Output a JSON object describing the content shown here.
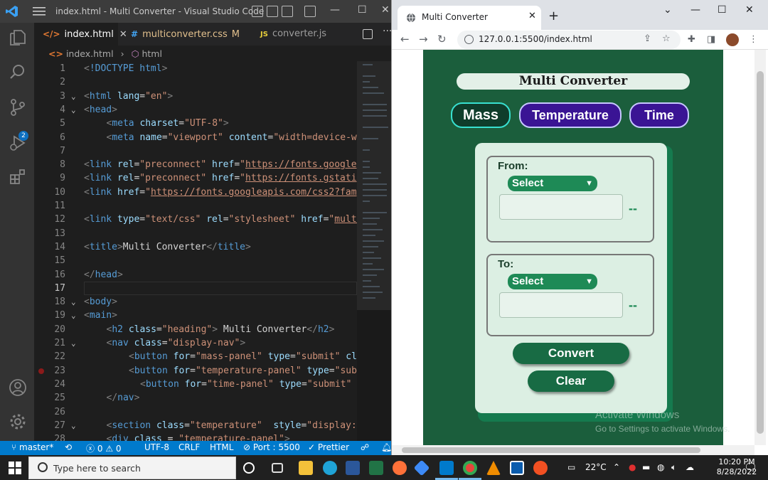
{
  "vscode": {
    "window_title": "index.html - Multi Converter - Visual Studio Code",
    "tabs": [
      {
        "icon": "</>",
        "label": "index.html",
        "active": true
      },
      {
        "icon": "#",
        "label": "multiconverter.css",
        "modified": "M"
      },
      {
        "icon": "JS",
        "label": "converter.js"
      }
    ],
    "breadcrumb": {
      "file": "index.html",
      "node": "html"
    },
    "scm_badge": "2",
    "lines": [
      {
        "n": "1",
        "tokens": [
          [
            "ang",
            "<"
          ],
          [
            "tag",
            "!DOCTYPE"
          ],
          [
            "txt",
            " "
          ],
          [
            "tag",
            "html"
          ],
          [
            "ang",
            ">"
          ]
        ]
      },
      {
        "n": "2",
        "tokens": []
      },
      {
        "n": "3",
        "fold": true,
        "tokens": [
          [
            "ang",
            "<"
          ],
          [
            "tag",
            "html"
          ],
          [
            "txt",
            " "
          ],
          [
            "attr",
            "lang"
          ],
          [
            "txt",
            "="
          ],
          [
            "str",
            "\"en\""
          ],
          [
            "ang",
            ">"
          ]
        ]
      },
      {
        "n": "4",
        "fold": true,
        "tokens": [
          [
            "ang",
            "<"
          ],
          [
            "tag",
            "head"
          ],
          [
            "ang",
            ">"
          ]
        ]
      },
      {
        "n": "5",
        "indent": 1,
        "tokens": [
          [
            "ang",
            "<"
          ],
          [
            "tag",
            "meta"
          ],
          [
            "txt",
            " "
          ],
          [
            "attr",
            "charset"
          ],
          [
            "txt",
            "="
          ],
          [
            "str",
            "\"UTF-8\""
          ],
          [
            "ang",
            ">"
          ]
        ]
      },
      {
        "n": "6",
        "indent": 1,
        "tokens": [
          [
            "ang",
            "<"
          ],
          [
            "tag",
            "meta"
          ],
          [
            "txt",
            " "
          ],
          [
            "attr",
            "name"
          ],
          [
            "txt",
            "="
          ],
          [
            "str",
            "\"viewport\""
          ],
          [
            "txt",
            " "
          ],
          [
            "attr",
            "content"
          ],
          [
            "txt",
            "="
          ],
          [
            "str",
            "\"width=device-w"
          ]
        ]
      },
      {
        "n": "7",
        "tokens": []
      },
      {
        "n": "8",
        "tokens": [
          [
            "ang",
            "<"
          ],
          [
            "tag",
            "link"
          ],
          [
            "txt",
            " "
          ],
          [
            "attr",
            "rel"
          ],
          [
            "txt",
            "="
          ],
          [
            "str",
            "\"preconnect\""
          ],
          [
            "txt",
            " "
          ],
          [
            "attr",
            "href"
          ],
          [
            "txt",
            "="
          ],
          [
            "str",
            "\""
          ],
          [
            "url",
            "https://fonts.google"
          ]
        ]
      },
      {
        "n": "9",
        "tokens": [
          [
            "ang",
            "<"
          ],
          [
            "tag",
            "link"
          ],
          [
            "txt",
            " "
          ],
          [
            "attr",
            "rel"
          ],
          [
            "txt",
            "="
          ],
          [
            "str",
            "\"preconnect\""
          ],
          [
            "txt",
            " "
          ],
          [
            "attr",
            "href"
          ],
          [
            "txt",
            "="
          ],
          [
            "str",
            "\""
          ],
          [
            "url",
            "https://fonts.gstati"
          ]
        ]
      },
      {
        "n": "10",
        "tokens": [
          [
            "ang",
            "<"
          ],
          [
            "tag",
            "link"
          ],
          [
            "txt",
            " "
          ],
          [
            "attr",
            "href"
          ],
          [
            "txt",
            "="
          ],
          [
            "str",
            "\""
          ],
          [
            "url",
            "https://fonts.googleapis.com/css2?fam"
          ]
        ]
      },
      {
        "n": "11",
        "tokens": []
      },
      {
        "n": "12",
        "tokens": [
          [
            "ang",
            "<"
          ],
          [
            "tag",
            "link"
          ],
          [
            "txt",
            " "
          ],
          [
            "attr",
            "type"
          ],
          [
            "txt",
            "="
          ],
          [
            "str",
            "\"text/css\""
          ],
          [
            "txt",
            " "
          ],
          [
            "attr",
            "rel"
          ],
          [
            "txt",
            "="
          ],
          [
            "str",
            "\"stylesheet\""
          ],
          [
            "txt",
            " "
          ],
          [
            "attr",
            "href"
          ],
          [
            "txt",
            "="
          ],
          [
            "str",
            "\""
          ],
          [
            "url",
            "multi"
          ]
        ]
      },
      {
        "n": "13",
        "tokens": []
      },
      {
        "n": "14",
        "tokens": [
          [
            "ang",
            "<"
          ],
          [
            "tag",
            "title"
          ],
          [
            "ang",
            ">"
          ],
          [
            "txt",
            "Multi Converter"
          ],
          [
            "ang",
            "</"
          ],
          [
            "tag",
            "title"
          ],
          [
            "ang",
            ">"
          ]
        ]
      },
      {
        "n": "15",
        "tokens": []
      },
      {
        "n": "16",
        "tokens": [
          [
            "ang",
            "</"
          ],
          [
            "tag",
            "head"
          ],
          [
            "ang",
            ">"
          ]
        ]
      },
      {
        "n": "17",
        "current": true,
        "tokens": []
      },
      {
        "n": "18",
        "fold": true,
        "tokens": [
          [
            "ang",
            "<"
          ],
          [
            "tag",
            "body"
          ],
          [
            "ang",
            ">"
          ]
        ]
      },
      {
        "n": "19",
        "fold": true,
        "tokens": [
          [
            "ang",
            "<"
          ],
          [
            "tag",
            "main"
          ],
          [
            "ang",
            ">"
          ]
        ]
      },
      {
        "n": "20",
        "indent": 1,
        "tokens": [
          [
            "ang",
            "<"
          ],
          [
            "tag",
            "h2"
          ],
          [
            "txt",
            " "
          ],
          [
            "attr",
            "class"
          ],
          [
            "txt",
            "="
          ],
          [
            "str",
            "\"heading\""
          ],
          [
            "ang",
            ">"
          ],
          [
            "txt",
            " Multi Converter"
          ],
          [
            "ang",
            "</"
          ],
          [
            "tag",
            "h2"
          ],
          [
            "ang",
            ">"
          ]
        ]
      },
      {
        "n": "21",
        "indent": 1,
        "fold": true,
        "tokens": [
          [
            "ang",
            "<"
          ],
          [
            "tag",
            "nav"
          ],
          [
            "txt",
            " "
          ],
          [
            "attr",
            "class"
          ],
          [
            "txt",
            "="
          ],
          [
            "str",
            "\"display-nav\""
          ],
          [
            "ang",
            ">"
          ]
        ]
      },
      {
        "n": "22",
        "indent": 2,
        "tokens": [
          [
            "ang",
            "<"
          ],
          [
            "tag",
            "button"
          ],
          [
            "txt",
            " "
          ],
          [
            "attr",
            "for"
          ],
          [
            "txt",
            "="
          ],
          [
            "str",
            "\"mass-panel\""
          ],
          [
            "txt",
            " "
          ],
          [
            "attr",
            "type"
          ],
          [
            "txt",
            "="
          ],
          [
            "str",
            "\"submit\""
          ],
          [
            "txt",
            " "
          ],
          [
            "attr",
            "cla"
          ]
        ]
      },
      {
        "n": "23",
        "indent": 2,
        "breakpoint": true,
        "tokens": [
          [
            "ang",
            "<"
          ],
          [
            "tag",
            "button"
          ],
          [
            "txt",
            " "
          ],
          [
            "attr",
            "for"
          ],
          [
            "txt",
            "="
          ],
          [
            "str",
            "\"temperature-panel\""
          ],
          [
            "txt",
            " "
          ],
          [
            "attr",
            "type"
          ],
          [
            "txt",
            "="
          ],
          [
            "str",
            "\"subm"
          ]
        ]
      },
      {
        "n": "24",
        "indent": 2,
        "extra": true,
        "tokens": [
          [
            "ang",
            "<"
          ],
          [
            "tag",
            "button"
          ],
          [
            "txt",
            " "
          ],
          [
            "attr",
            "for"
          ],
          [
            "txt",
            "="
          ],
          [
            "str",
            "\"time-panel\""
          ],
          [
            "txt",
            " "
          ],
          [
            "attr",
            "type"
          ],
          [
            "txt",
            "="
          ],
          [
            "str",
            "\"submit\""
          ],
          [
            "txt",
            " "
          ],
          [
            "attr",
            "c"
          ]
        ]
      },
      {
        "n": "25",
        "indent": 1,
        "tokens": [
          [
            "ang",
            "</"
          ],
          [
            "tag",
            "nav"
          ],
          [
            "ang",
            ">"
          ]
        ]
      },
      {
        "n": "26",
        "tokens": []
      },
      {
        "n": "27",
        "indent": 1,
        "fold": true,
        "tokens": [
          [
            "ang",
            "<"
          ],
          [
            "tag",
            "section"
          ],
          [
            "txt",
            " "
          ],
          [
            "attr",
            "class"
          ],
          [
            "txt",
            "="
          ],
          [
            "str",
            "\"temperature\""
          ],
          [
            "txt",
            "  "
          ],
          [
            "attr",
            "style"
          ],
          [
            "txt",
            "="
          ],
          [
            "str",
            "\"display:"
          ]
        ]
      },
      {
        "n": "28",
        "indent": 1,
        "tokens": [
          [
            "ang",
            "<"
          ],
          [
            "tag",
            "div"
          ],
          [
            "txt",
            " "
          ],
          [
            "attr",
            "class"
          ],
          [
            "txt",
            " = "
          ],
          [
            "str",
            "\"temperature-panel\""
          ],
          [
            "ang",
            ">"
          ]
        ]
      }
    ],
    "status": {
      "branch": "master*",
      "errors": "0",
      "warnings": "0",
      "encoding": "UTF-8",
      "eol": "CRLF",
      "language": "HTML",
      "port": "Port : 5500",
      "prettier": "Prettier"
    }
  },
  "chrome": {
    "tab_title": "Multi Converter",
    "url": "127.0.0.1:5500/index.html"
  },
  "app": {
    "heading": "Multi Converter",
    "nav": {
      "mass": "Mass",
      "temperature": "Temperature",
      "time": "Time"
    },
    "from": {
      "label": "From:",
      "select": "Select",
      "result": "--"
    },
    "to": {
      "label": "To:",
      "select": "Select",
      "result": "--"
    },
    "convert": "Convert",
    "clear": "Clear",
    "watermark_title": "Activate Windows",
    "watermark_sub": "Go to Settings to activate Windows."
  },
  "taskbar": {
    "search_placeholder": "Type here to search",
    "temperature": "22°C",
    "time": "10:20 PM",
    "date": "8/28/2022"
  },
  "colors": {
    "vscode_bg": "#1e1e1e",
    "status_bar": "#007acc",
    "app_bg": "#1b5e3c",
    "nav_button": "#3a1494",
    "mass_active": "#0f3d2b",
    "action_button": "#186b44"
  }
}
